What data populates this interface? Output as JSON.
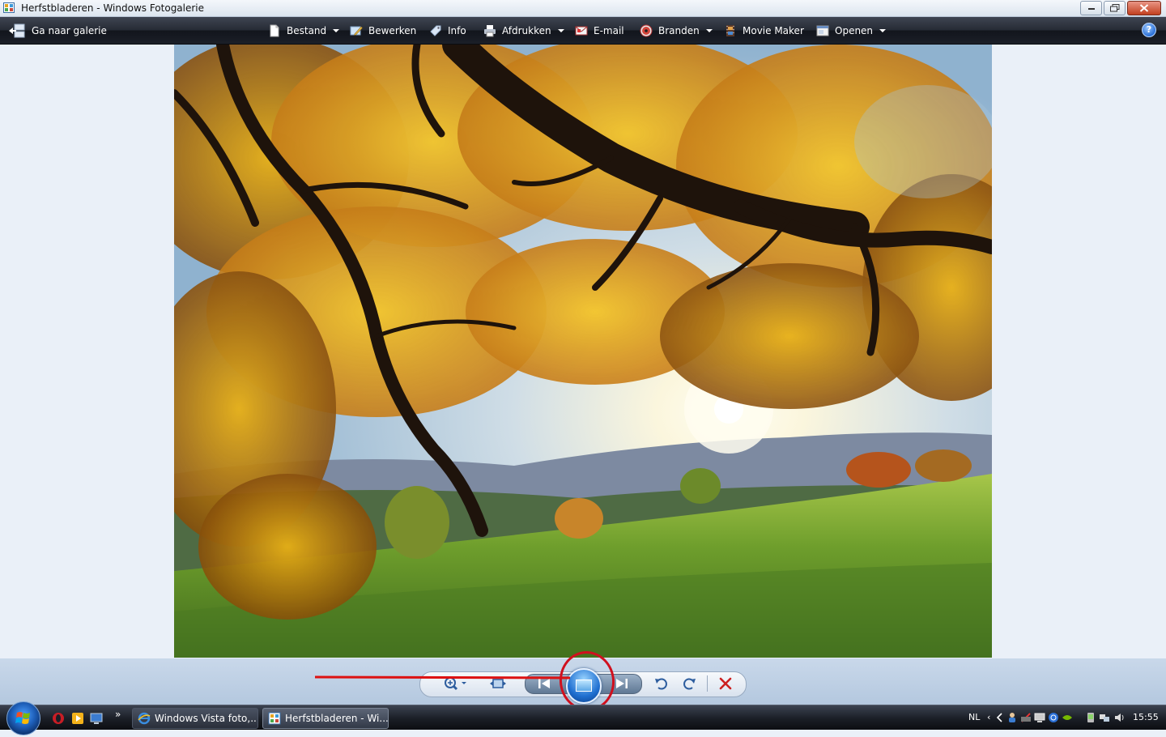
{
  "window": {
    "title": "Herfstbladeren - Windows Fotogalerie"
  },
  "toolbar": {
    "go_to_gallery": "Ga naar galerie",
    "file": "Bestand",
    "edit": "Bewerken",
    "info": "Info",
    "print": "Afdrukken",
    "email": "E-mail",
    "burn": "Branden",
    "movie_maker": "Movie Maker",
    "open": "Openen",
    "help": "?"
  },
  "taskbar": {
    "tasks": [
      {
        "label": "Windows Vista foto,..."
      },
      {
        "label": "Herfstbladeren - Wi..."
      }
    ],
    "quicklaunch_more": "»",
    "language": "NL",
    "tray_chevron": "‹",
    "clock": "15:55"
  },
  "colors": {
    "annotation": "#d0101e",
    "toolbar_bg": "#1b1f28",
    "viewer_bg": "#eaf0f8",
    "controlbar_bg": "#b4c8df"
  },
  "icons": {
    "titlebar": "gallery-app-icon",
    "controls": [
      "zoom-icon",
      "actual-size-icon",
      "previous-icon",
      "slideshow-icon",
      "next-icon",
      "rotate-left-icon",
      "rotate-right-icon",
      "delete-icon"
    ]
  }
}
